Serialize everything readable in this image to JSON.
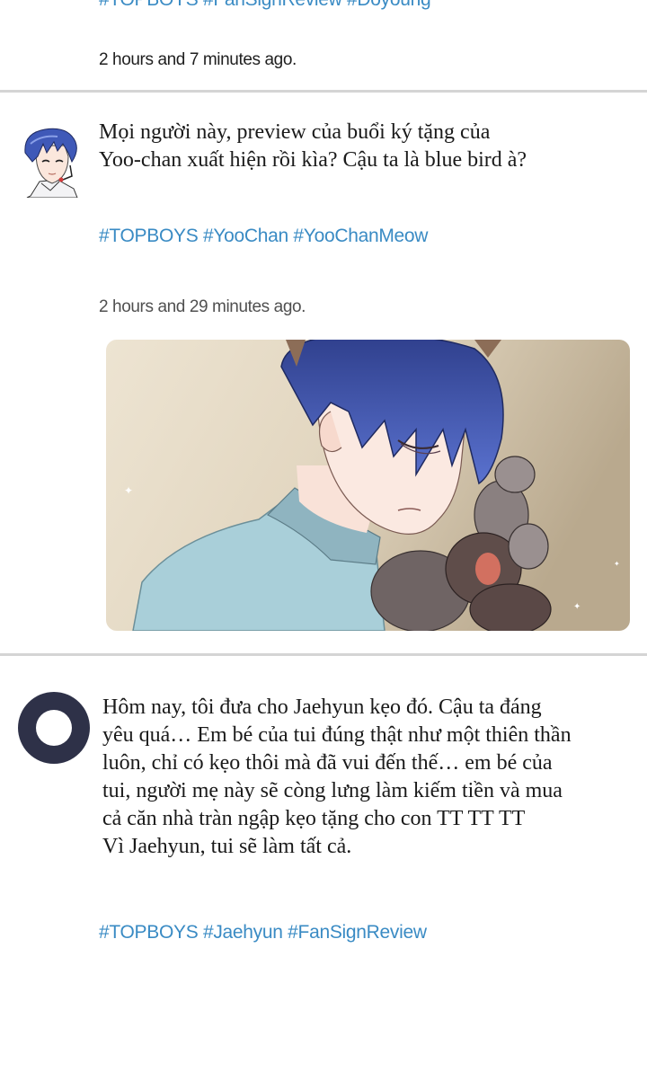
{
  "feed": {
    "post_prev": {
      "hashtags_cut": "#TOPBOYS #FanSignReview #Doyoung",
      "timestamp": "2 hours and 7 minutes ago."
    },
    "post_1": {
      "text": "Mọi người này, preview của buổi ký tặng của\nYoo-chan xuất hiện rồi kìa? Cậu ta là blue bird à?",
      "hashtags": "#TOPBOYS #YooChan  #YooChanMeow",
      "timestamp": "2 hours and 29 minutes ago."
    },
    "post_2": {
      "text": "Hôm nay, tôi đưa cho Jaehyun kẹo đó. Cậu ta đáng\nyêu quá… Em bé của tui đúng thật như một thiên thần\nluôn, chỉ có kẹo thôi mà đã vui đến thế… em bé của\ntui, người mẹ này sẽ còng lưng làm kiếm tiền và mua\ncả căn nhà tràn ngập kẹo tặng cho con TT TT TT\nVì Jaehyun, tui sẽ làm tất cả.",
      "hashtags": "#TOPBOYS #Jaehyun #FanSignReview"
    }
  },
  "colors": {
    "hashtag": "#3a8bc4",
    "divider": "#d4d4d4",
    "avatar_generic": "#2e3148"
  }
}
